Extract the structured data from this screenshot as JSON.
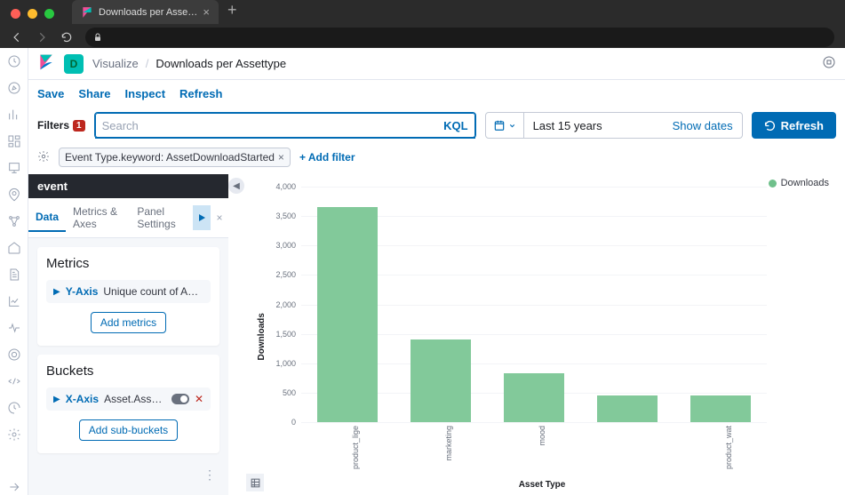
{
  "browser": {
    "tab_title": "Downloads per Assettype - Kib…"
  },
  "breadcrumb": {
    "app": "Visualize",
    "page": "Downloads per Assettype"
  },
  "actions": {
    "save": "Save",
    "share": "Share",
    "inspect": "Inspect",
    "refresh": "Refresh"
  },
  "filters": {
    "label": "Filters",
    "count": "1",
    "search_placeholder": "Search",
    "kql": "KQL",
    "timerange": "Last 15 years",
    "show_dates": "Show dates",
    "refresh_btn": "Refresh",
    "pill": "Event Type.keyword: AssetDownloadStarted",
    "add_filter": "+ Add filter"
  },
  "panel": {
    "title": "event",
    "tabs": {
      "data": "Data",
      "axes": "Metrics & Axes",
      "settings": "Panel Settings"
    },
    "metrics": {
      "heading": "Metrics",
      "y_label": "Y-Axis",
      "y_desc": "Unique count of Asset Id",
      "add": "Add metrics"
    },
    "buckets": {
      "heading": "Buckets",
      "x_label": "X-Axis",
      "x_desc": "Asset.Asset Type Nam...",
      "add": "Add sub-buckets"
    }
  },
  "legend": {
    "series": "Downloads"
  },
  "axes": {
    "x": "Asset Type",
    "y": "Downloads"
  },
  "chart_data": {
    "type": "bar",
    "title": "Downloads per Assettype",
    "xlabel": "Asset Type",
    "ylabel": "Downloads",
    "ylim": [
      0,
      4000
    ],
    "y_ticks": [
      0,
      500,
      1000,
      1500,
      2000,
      2500,
      3000,
      3500,
      4000
    ],
    "series": [
      {
        "name": "Downloads",
        "color": "#82c99a"
      }
    ],
    "categories": [
      "product_lige",
      "marketing",
      "mood",
      "",
      "product_wat"
    ],
    "values": [
      3650,
      1400,
      830,
      460,
      450
    ]
  }
}
